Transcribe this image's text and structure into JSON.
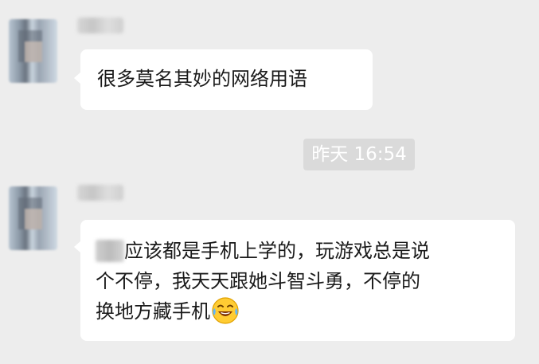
{
  "messages": [
    {
      "text": "很多莫名其妙的网络用语"
    },
    {
      "lines": [
        "应该都是手机上学的，玩游戏总是说",
        "个不停，我天天跟她斗智斗勇，不停的",
        "换地方藏手机"
      ],
      "emoji": "face-with-tears-of-joy"
    }
  ],
  "timestamp": "昨天 16:54",
  "colors": {
    "background": "#ededed",
    "bubble": "#ffffff",
    "timestamp_bg": "#dadada",
    "timestamp_text": "#ffffff",
    "text": "#1a1a1a"
  }
}
